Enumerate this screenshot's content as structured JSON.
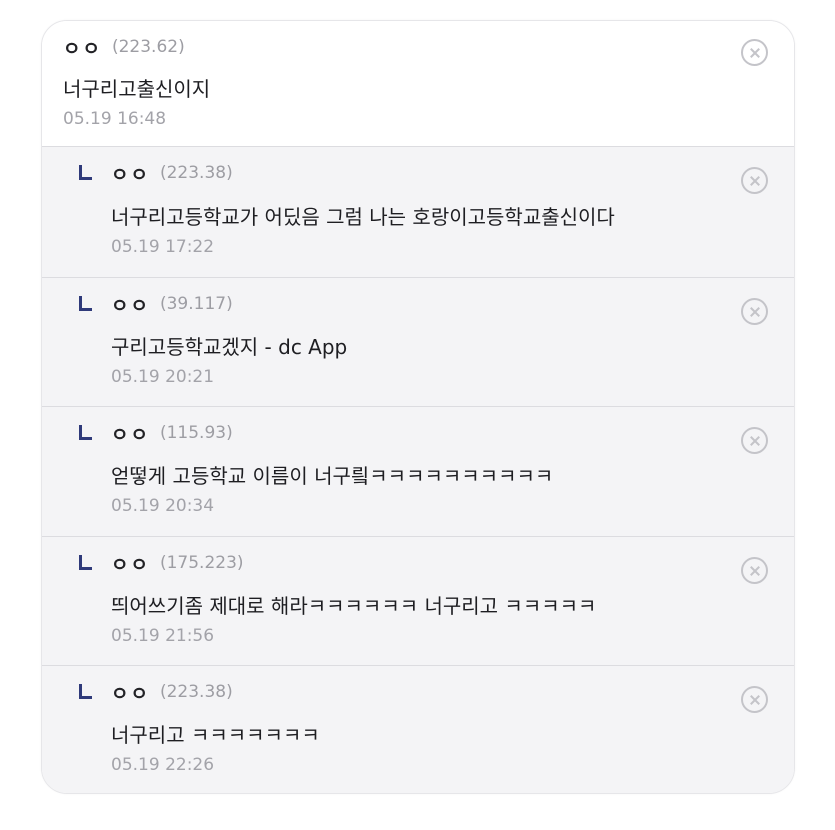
{
  "comments": [
    {
      "nick": "ㅇㅇ",
      "ip": "(223.62)",
      "text": "너구리고출신이지",
      "time": "05.19 16:48",
      "is_reply": false
    },
    {
      "nick": "ㅇㅇ",
      "ip": "(223.38)",
      "text": "너구리고등학교가 어딨음 그럼 나는 호랑이고등학교출신이다",
      "time": "05.19 17:22",
      "is_reply": true
    },
    {
      "nick": "ㅇㅇ",
      "ip": "(39.117)",
      "text": "구리고등학교겠지 - dc App",
      "time": "05.19 20:21",
      "is_reply": true
    },
    {
      "nick": "ㅇㅇ",
      "ip": "(115.93)",
      "text": "얻떻게 고등학교 이름이 너구릨ㅋㅋㅋㅋㅋㅋㅋㅋㅋㅋ",
      "time": "05.19 20:34",
      "is_reply": true
    },
    {
      "nick": "ㅇㅇ",
      "ip": "(175.223)",
      "text": "띄어쓰기좀 제대로 해라ㅋㅋㅋㅋㅋㅋ 너구리고 ㅋㅋㅋㅋㅋ",
      "time": "05.19 21:56",
      "is_reply": true
    },
    {
      "nick": "ㅇㅇ",
      "ip": "(223.38)",
      "text": "너구리고 ㅋㅋㅋㅋㅋㅋㅋ",
      "time": "05.19 22:26",
      "is_reply": true
    }
  ],
  "icons": {
    "delete": "close-circle-icon",
    "reply": "reply-arrow-icon"
  },
  "colors": {
    "reply_bg": "#f4f4f6",
    "reply_mark": "#2f3a7a",
    "muted": "#a3a3a9"
  }
}
